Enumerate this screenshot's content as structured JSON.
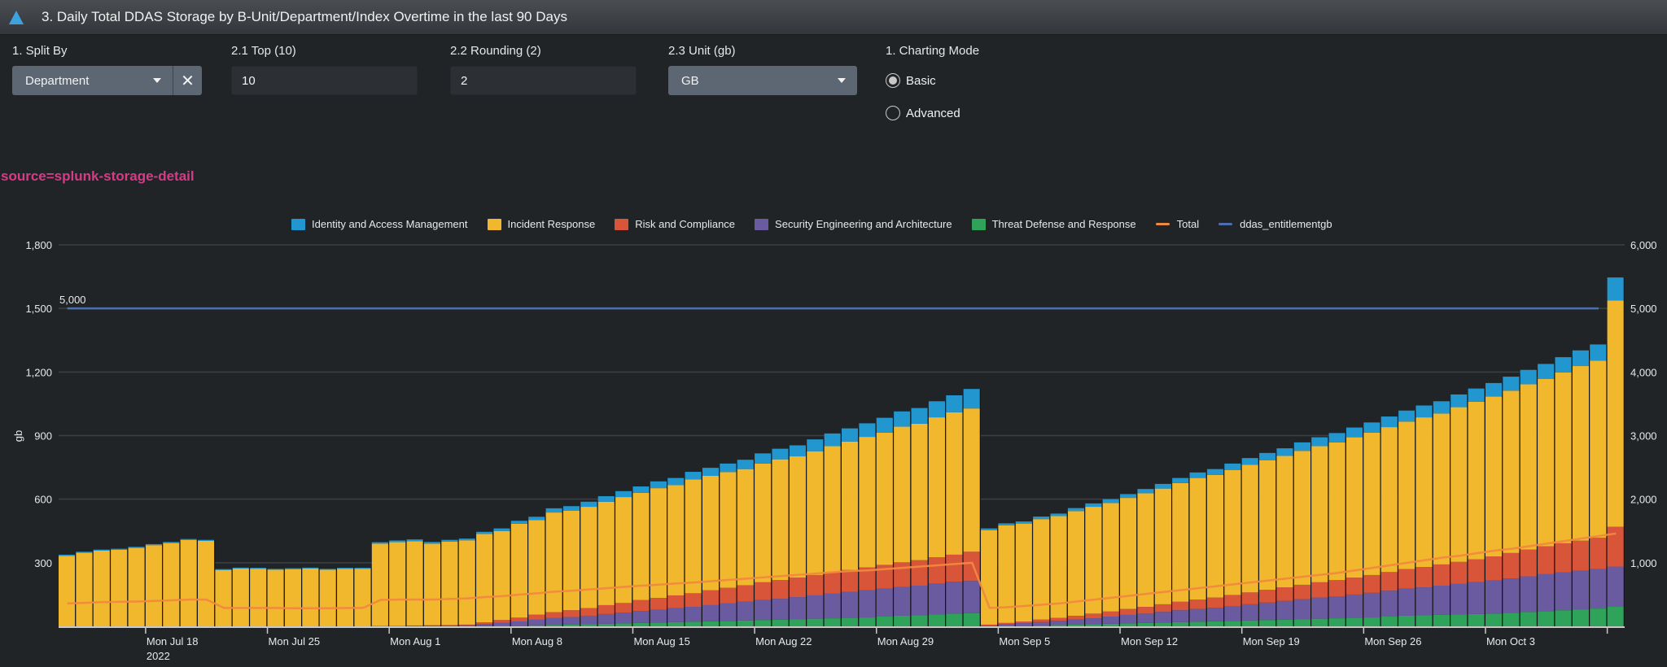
{
  "panel": {
    "title": "3. Daily Total DDAS Storage by B-Unit/Department/Index Overtime in the last 90 Days",
    "icon": "triangle-icon"
  },
  "inputs": {
    "split_by": {
      "label": "1. Split By",
      "value": "Department"
    },
    "top": {
      "label": "2.1 Top (10)",
      "value": "10"
    },
    "rounding": {
      "label": "2.2 Rounding (2)",
      "value": "2"
    },
    "unit": {
      "label": "2.3 Unit (gb)",
      "value": "GB"
    },
    "charting_mode": {
      "label": "1. Charting Mode",
      "options": [
        {
          "label": "Basic",
          "selected": true
        },
        {
          "label": "Advanced",
          "selected": false
        }
      ]
    }
  },
  "source_label": "source=splunk-storage-detail",
  "colors": {
    "Identity and Access Management": "#2196cf",
    "Incident Response": "#f1b82d",
    "Risk and Compliance": "#d9553a",
    "Security Engineering and Architecture": "#6a5a9f",
    "Threat Defense and Response": "#2fa35a",
    "Total": "#f0883e",
    "ddas_entitlementgb": "#4e6fae"
  },
  "chart_data": {
    "type": "bar",
    "stacked": true,
    "title": "",
    "xlabel": "",
    "ylabel": "gb",
    "ylim": [
      0,
      1800
    ],
    "y_ticks": [
      "300",
      "600",
      "900",
      "1,200",
      "1,500",
      "1,800"
    ],
    "y_tick_values": [
      300,
      600,
      900,
      1200,
      1500,
      1800
    ],
    "y2lim": [
      0,
      6000
    ],
    "y2_ticks": [
      "1,000",
      "2,000",
      "3,000",
      "4,000",
      "5,000",
      "6,000"
    ],
    "y2_tick_values": [
      1000,
      2000,
      3000,
      4000,
      5000,
      6000
    ],
    "grid": true,
    "legend_position": "top",
    "x_start": "2022-07-13",
    "x_tick_labels": [
      "Mon Jul 18",
      "Mon Jul 25",
      "Mon Aug 1",
      "Mon Aug 8",
      "Mon Aug 15",
      "Mon Aug 22",
      "Mon Aug 29",
      "Mon Sep 5",
      "Mon Sep 12",
      "Mon Sep 19",
      "Mon Sep 26",
      "Mon Oct 3"
    ],
    "x_tick_day_index": [
      5,
      12,
      19,
      26,
      33,
      40,
      47,
      54,
      61,
      68,
      75,
      82
    ],
    "x_tick_sublabel": "2022",
    "entitlement_annotation": "5,000",
    "series": [
      {
        "name": "Threat Defense and Response",
        "axis": "left",
        "values": [
          0,
          0,
          0,
          0,
          0,
          0,
          0,
          0,
          0,
          0,
          0,
          0,
          0,
          0,
          0,
          0,
          0,
          0,
          0,
          0,
          0,
          0,
          0,
          0,
          1,
          2,
          3,
          5,
          7,
          8,
          10,
          12,
          14,
          16,
          18,
          20,
          22,
          24,
          26,
          28,
          30,
          32,
          34,
          36,
          38,
          40,
          42,
          46,
          50,
          52,
          56,
          60,
          62,
          0,
          2,
          3,
          4,
          6,
          8,
          10,
          12,
          14,
          16,
          18,
          20,
          22,
          24,
          26,
          28,
          30,
          32,
          34,
          36,
          38,
          40,
          42,
          46,
          50,
          52,
          54,
          56,
          58,
          60,
          64,
          68,
          72,
          76,
          80,
          84,
          92
        ]
      },
      {
        "name": "Security Engineering and Architecture",
        "axis": "left",
        "values": [
          0,
          0,
          0,
          0,
          0,
          0,
          0,
          0,
          0,
          0,
          0,
          0,
          0,
          0,
          0,
          0,
          0,
          0,
          0,
          0,
          2,
          3,
          4,
          5,
          10,
          14,
          20,
          26,
          32,
          36,
          40,
          46,
          50,
          56,
          60,
          66,
          70,
          76,
          82,
          88,
          94,
          98,
          104,
          110,
          116,
          122,
          128,
          132,
          136,
          140,
          146,
          150,
          152,
          4,
          8,
          12,
          16,
          20,
          24,
          28,
          34,
          40,
          44,
          50,
          56,
          60,
          64,
          70,
          76,
          82,
          88,
          94,
          100,
          104,
          110,
          116,
          122,
          128,
          132,
          138,
          144,
          150,
          156,
          162,
          168,
          174,
          178,
          182,
          186,
          190
        ]
      },
      {
        "name": "Risk and Compliance",
        "axis": "left",
        "values": [
          0,
          0,
          0,
          0,
          0,
          0,
          0,
          0,
          0,
          0,
          0,
          0,
          0,
          0,
          0,
          0,
          0,
          0,
          2,
          2,
          2,
          2,
          2,
          3,
          8,
          14,
          18,
          24,
          28,
          32,
          36,
          42,
          46,
          52,
          56,
          60,
          64,
          70,
          74,
          78,
          84,
          88,
          92,
          96,
          100,
          104,
          108,
          112,
          116,
          120,
          124,
          128,
          138,
          4,
          6,
          8,
          12,
          14,
          18,
          22,
          24,
          28,
          32,
          36,
          40,
          44,
          48,
          52,
          56,
          60,
          64,
          68,
          72,
          76,
          80,
          84,
          88,
          92,
          96,
          100,
          104,
          108,
          114,
          120,
          126,
          132,
          138,
          142,
          148,
          188
        ]
      },
      {
        "name": "Incident Response",
        "axis": "left",
        "values": [
          333,
          347,
          357,
          361,
          370,
          383,
          393,
          407,
          403,
          266,
          273,
          272,
          267,
          270,
          273,
          267,
          272,
          272,
          388,
          395,
          398,
          385,
          394,
          398,
          417,
          420,
          443,
          446,
          470,
          469,
          478,
          488,
          500,
          506,
          518,
          520,
          537,
          540,
          546,
          548,
          560,
          570,
          572,
          584,
          596,
          606,
          616,
          624,
          640,
          644,
          660,
          672,
          676,
          446,
          460,
          462,
          474,
          480,
          494,
          504,
          512,
          524,
          536,
          546,
          560,
          574,
          578,
          590,
          602,
          612,
          620,
          632,
          642,
          650,
          662,
          672,
          684,
          696,
          706,
          712,
          730,
          744,
          754,
          766,
          780,
          790,
          806,
          824,
          836,
          1068
        ]
      },
      {
        "name": "Identity and Access Management",
        "axis": "left",
        "values": [
          5,
          5,
          5,
          5,
          5,
          5,
          5,
          5,
          5,
          4,
          4,
          4,
          4,
          4,
          4,
          4,
          4,
          4,
          7,
          8,
          8,
          8,
          8,
          8,
          10,
          12,
          14,
          16,
          20,
          22,
          24,
          26,
          28,
          30,
          32,
          34,
          36,
          38,
          40,
          44,
          48,
          50,
          52,
          56,
          60,
          62,
          64,
          70,
          72,
          74,
          76,
          80,
          92,
          8,
          10,
          10,
          12,
          12,
          14,
          16,
          18,
          18,
          20,
          22,
          24,
          26,
          28,
          30,
          32,
          34,
          36,
          40,
          42,
          44,
          46,
          48,
          50,
          52,
          56,
          58,
          60,
          62,
          64,
          66,
          68,
          70,
          72,
          74,
          76,
          108
        ]
      },
      {
        "name": "Total",
        "type": "line",
        "axis": "right",
        "values": [
          360,
          370,
          380,
          385,
          390,
          400,
          410,
          420,
          420,
          290,
          290,
          290,
          290,
          285,
          285,
          285,
          290,
          290,
          415,
          420,
          420,
          420,
          430,
          440,
          460,
          475,
          500,
          520,
          545,
          560,
          580,
          600,
          620,
          640,
          655,
          675,
          690,
          710,
          730,
          750,
          770,
          790,
          810,
          830,
          850,
          870,
          880,
          900,
          920,
          940,
          960,
          980,
          1000,
          290,
          300,
          320,
          340,
          360,
          390,
          420,
          450,
          480,
          510,
          540,
          570,
          600,
          630,
          660,
          690,
          720,
          750,
          780,
          810,
          840,
          880,
          920,
          960,
          1000,
          1040,
          1080,
          1110,
          1150,
          1190,
          1220,
          1260,
          1300,
          1340,
          1380,
          1420,
          1460
        ]
      },
      {
        "name": "ddas_entitlementgb",
        "type": "line",
        "axis": "right",
        "values_constant": 5000,
        "day_range": [
          0,
          88
        ]
      }
    ]
  }
}
